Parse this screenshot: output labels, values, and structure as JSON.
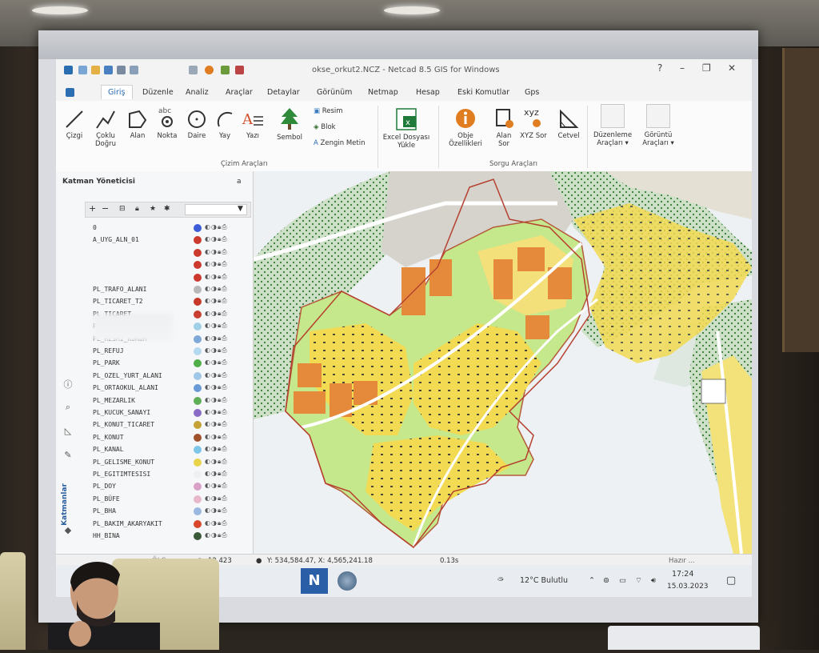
{
  "window": {
    "title": "okse_orkut2.NCZ - Netcad 8.5 GIS for Windows",
    "controls": [
      "?",
      "–",
      "❐",
      "✕"
    ]
  },
  "tabs": [
    "Giriş",
    "Düzenle",
    "Analiz",
    "Araçlar",
    "Detaylar",
    "Görünüm",
    "Netmap",
    "Hesap",
    "Eski Komutlar",
    "Gps"
  ],
  "active_tab": "Giriş",
  "ribbon": {
    "drawing": {
      "group_label": "Çizim Araçları",
      "buttons": [
        "Çizgi",
        "Çoklu Doğru",
        "Alan",
        "Nokta",
        "Daire",
        "Yay",
        "Yazı",
        "Sembol"
      ],
      "small_buttons": [
        "Resim",
        "Blok",
        "Zengin Metin"
      ]
    },
    "excel_label": "Excel Dosyası Yükle",
    "query": {
      "group_label": "Sorgu Araçları",
      "buttons": [
        "Obje Özellikleri",
        "Alan Sor",
        "XYZ Sor",
        "Cetvel"
      ],
      "xyz_text": "xyz"
    },
    "edit_tools": "Düzenleme Araçları",
    "view_tools": "Görüntü Araçları"
  },
  "layer_panel": {
    "title": "Katman Yöneticisi",
    "pin": "a",
    "side_label": "Katmanlar",
    "layers": [
      {
        "name": "0",
        "color": "#3b5bd9"
      },
      {
        "name": "A_UYG_ALN_01",
        "color": "#cc3a2e"
      },
      {
        "name": "",
        "color": "#cc3a2e"
      },
      {
        "name": "",
        "color": "#cc3a2e"
      },
      {
        "name": "",
        "color": "#cc3a2e"
      },
      {
        "name": "PL_TRAFO_ALANI",
        "color": "#b8b8b8"
      },
      {
        "name": "PL_TICARET_T2",
        "color": "#c73a2a"
      },
      {
        "name": "PL_TICARET",
        "color": "#c94032"
      },
      {
        "name": "PL_SOSYAL_TESIS",
        "color": "#9fd0e8"
      },
      {
        "name": "PL_RESMI_KURUM",
        "color": "#7ea8d8"
      },
      {
        "name": "PL_REFUJ",
        "color": "#b4d8ee"
      },
      {
        "name": "PL_PARK",
        "color": "#4fae48"
      },
      {
        "name": "PL_OZEL_YURT_ALANI",
        "color": "#9fc7e8"
      },
      {
        "name": "PL_ORTAOKUL_ALANI",
        "color": "#6a9ad6"
      },
      {
        "name": "PL_MEZARLIK",
        "color": "#5fae58"
      },
      {
        "name": "PL_KUCUK_SANAYI",
        "color": "#8a6cc7"
      },
      {
        "name": "PL_KONUT_TICARET",
        "color": "#c4a236"
      },
      {
        "name": "PL_KONUT",
        "color": "#a0522d"
      },
      {
        "name": "PL_KANAL",
        "color": "#7ec6e8"
      },
      {
        "name": "PL_GELISME_KONUT",
        "color": "#e8d34a"
      },
      {
        "name": "PL_EGITIMTESISI",
        "color": "#f0f0f0"
      },
      {
        "name": "PL_DOY",
        "color": "#d9a0c8"
      },
      {
        "name": "PL_BÜFE",
        "color": "#e6b8c8"
      },
      {
        "name": "PL_BHA",
        "color": "#9ab8e0"
      },
      {
        "name": "PL_BAKIM_AKARYAKIT",
        "color": "#d9482c"
      },
      {
        "name": "HH_BINA",
        "color": "#3a5a3a"
      }
    ]
  },
  "status": {
    "scale": "12.423",
    "coords": "Y: 534,584.47, X: 4,565,241.18",
    "time": "0.13s",
    "ready": "Hazır ..."
  },
  "taskbar": {
    "weather": "12°C  Bulutlu",
    "clock_time": "17:24",
    "clock_date": "15.03.2023"
  }
}
